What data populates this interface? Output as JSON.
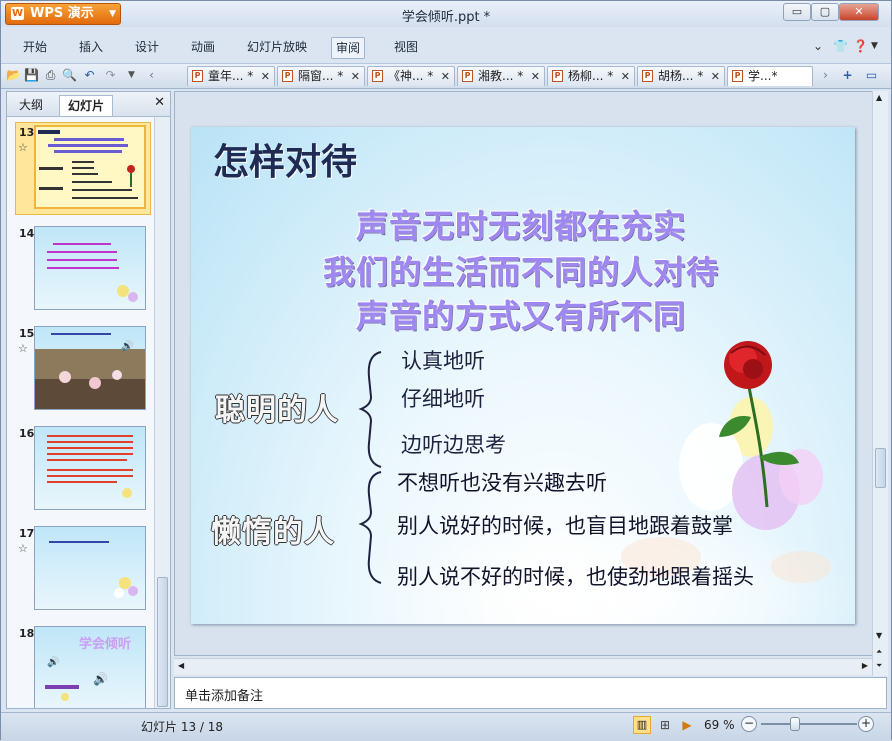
{
  "app": {
    "name": "WPS 演示",
    "title": "学会倾听.ppt *"
  },
  "window_controls": {
    "minimize": "▭",
    "maximize": "▢",
    "close": "✕"
  },
  "menu": {
    "items": [
      "开始",
      "插入",
      "设计",
      "动画",
      "幻灯片放映",
      "审阅",
      "视图"
    ],
    "active_index": 5,
    "right_icons": [
      "shirt-icon",
      "help-icon"
    ]
  },
  "doc_tabs": [
    {
      "label": "童年... *"
    },
    {
      "label": "隔窗... *"
    },
    {
      "label": "《神... *"
    },
    {
      "label": "湘教... *"
    },
    {
      "label": "杨柳... *"
    },
    {
      "label": "胡杨... *"
    },
    {
      "label": "学...*"
    }
  ],
  "left_panel": {
    "tabs": [
      "大纲",
      "幻灯片"
    ],
    "active_tab": "幻灯片",
    "close": "✕",
    "slides": [
      {
        "number": "13",
        "has_anim": true,
        "selected": true
      },
      {
        "number": "14",
        "has_anim": false,
        "selected": false
      },
      {
        "number": "15",
        "has_anim": true,
        "selected": false
      },
      {
        "number": "16",
        "has_anim": false,
        "selected": false
      },
      {
        "number": "17",
        "has_anim": true,
        "selected": false
      },
      {
        "number": "18",
        "has_anim": false,
        "selected": false
      }
    ],
    "thumb_text": {
      "t18_title": "学会倾听"
    }
  },
  "slide": {
    "title": "怎样对待",
    "heading_lines": [
      "声音无时无刻都在充实",
      "我们的生活而不同的人对待",
      "声音的方式又有所不同"
    ],
    "group1": {
      "label": "聪明的人",
      "items": [
        "认真地听",
        "仔细地听",
        "边听边思考"
      ]
    },
    "group2": {
      "label": "懒惰的人",
      "items": [
        "不想听也没有兴趣去听",
        "别人说好的时候，也盲目地跟着鼓掌",
        "别人说不好的时候，也使劲地跟着摇头"
      ]
    }
  },
  "notes_placeholder": "单击添加备注",
  "status": {
    "slide_counter": "幻灯片 13 / 18",
    "zoom": "69 %",
    "zoom_fraction": 0.35
  }
}
